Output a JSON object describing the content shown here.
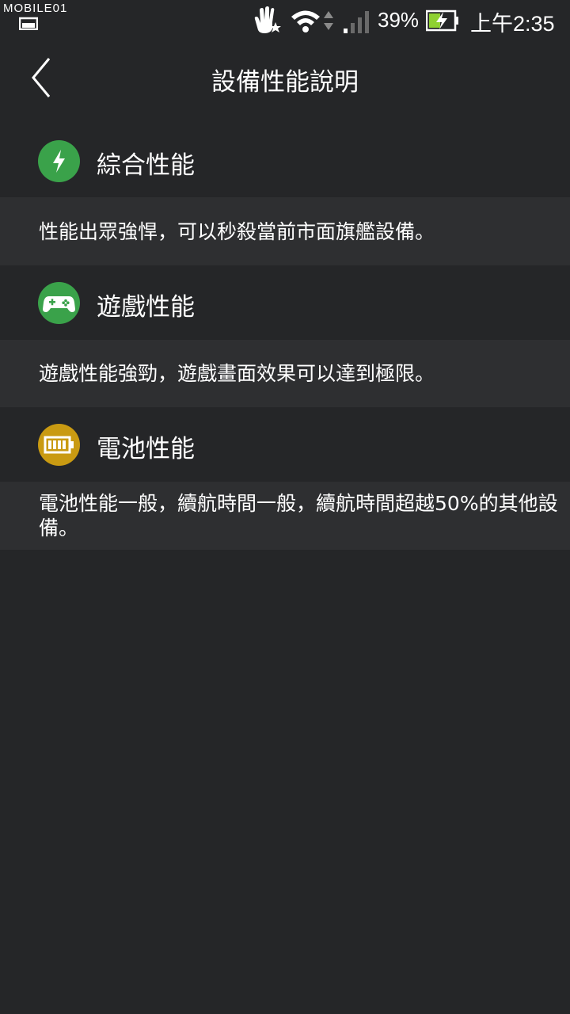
{
  "status_bar": {
    "watermark": "MOBILE01",
    "battery_percent": "39%",
    "time": "上午2:35"
  },
  "header": {
    "title": "設備性能說明",
    "back_icon": "chevron-left-icon"
  },
  "sections": [
    {
      "title": "綜合性能",
      "icon": "lightning-icon",
      "icon_color": "#3aa24a",
      "description": "性能出眾強悍，可以秒殺當前市面旗艦設備。"
    },
    {
      "title": "遊戲性能",
      "icon": "gamepad-icon",
      "icon_color": "#3aa24a",
      "description": "遊戲性能強勁，遊戲畫面效果可以達到極限。"
    },
    {
      "title": "電池性能",
      "icon": "battery-icon",
      "icon_color": "#c99a12",
      "description": "電池性能一般，續航時間一般，續航時間超越50%的其他設備。"
    }
  ],
  "colors": {
    "background": "#252628",
    "row_background": "#2e2f31",
    "text": "#ffffff"
  }
}
